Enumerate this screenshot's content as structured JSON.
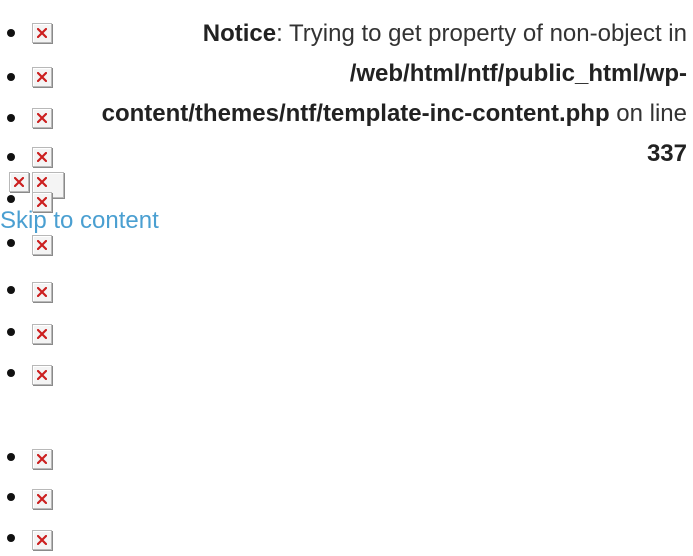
{
  "notice": {
    "label": "Notice",
    "message": ": Trying to get property of non-object in ",
    "path": "/web/html/ntf/public_html/wp-content/themes/ntf/template-inc-content.php",
    "line_text": " on line ",
    "line_number": "337"
  },
  "skip_link": {
    "label": "Skip to content"
  },
  "icons": {
    "broken_image": "broken-image-icon",
    "x_color": "#cc1f1f"
  },
  "menu": {
    "item_count": 14
  }
}
